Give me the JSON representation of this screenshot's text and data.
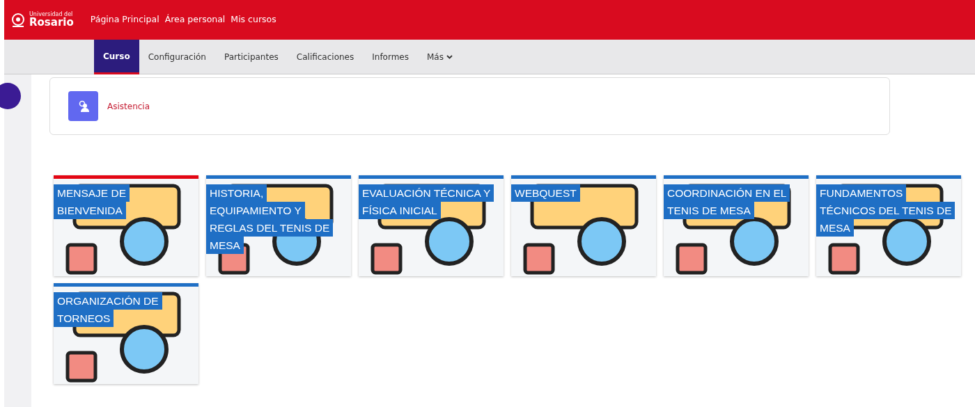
{
  "brand": {
    "small": "Universidad del",
    "name": "Rosario"
  },
  "top_nav": [
    {
      "label": "Página Principal"
    },
    {
      "label": "Área personal"
    },
    {
      "label": "Mis cursos"
    }
  ],
  "course_nav": [
    {
      "label": "Curso",
      "selected": true
    },
    {
      "label": "Configuración",
      "selected": false
    },
    {
      "label": "Participantes",
      "selected": false
    },
    {
      "label": "Calificaciones",
      "selected": false
    },
    {
      "label": "Informes",
      "selected": false
    },
    {
      "label": "Más",
      "selected": false,
      "dropdown": true
    }
  ],
  "activity": {
    "label": "Asistencia"
  },
  "tiles": [
    {
      "title_lines": [
        "MENSAJE DE",
        "BIENVENIDA"
      ],
      "color": "#e30613"
    },
    {
      "title_lines": [
        "HISTORIA,",
        "EQUIPAMIENTO Y",
        "REGLAS DEL TENIS DE",
        "MESA"
      ],
      "color": "#1f6fc5"
    },
    {
      "title_lines": [
        "EVALUACIÓN TÉCNICA Y",
        "FÍSICA INICIAL"
      ],
      "color": "#1f6fc5"
    },
    {
      "title_lines": [
        "WEBQUEST"
      ],
      "color": "#1f6fc5"
    },
    {
      "title_lines": [
        "COORDINACIÓN EN EL",
        "TENIS DE MESA"
      ],
      "color": "#1f6fc5"
    },
    {
      "title_lines": [
        "FUNDAMENTOS",
        "TÉCNICOS DEL TENIS DE",
        "MESA"
      ],
      "color": "#1f6fc5"
    },
    {
      "title_lines": [
        "ORGANIZACIÓN DE",
        "TORNEOS"
      ],
      "color": "#1f6fc5"
    }
  ]
}
